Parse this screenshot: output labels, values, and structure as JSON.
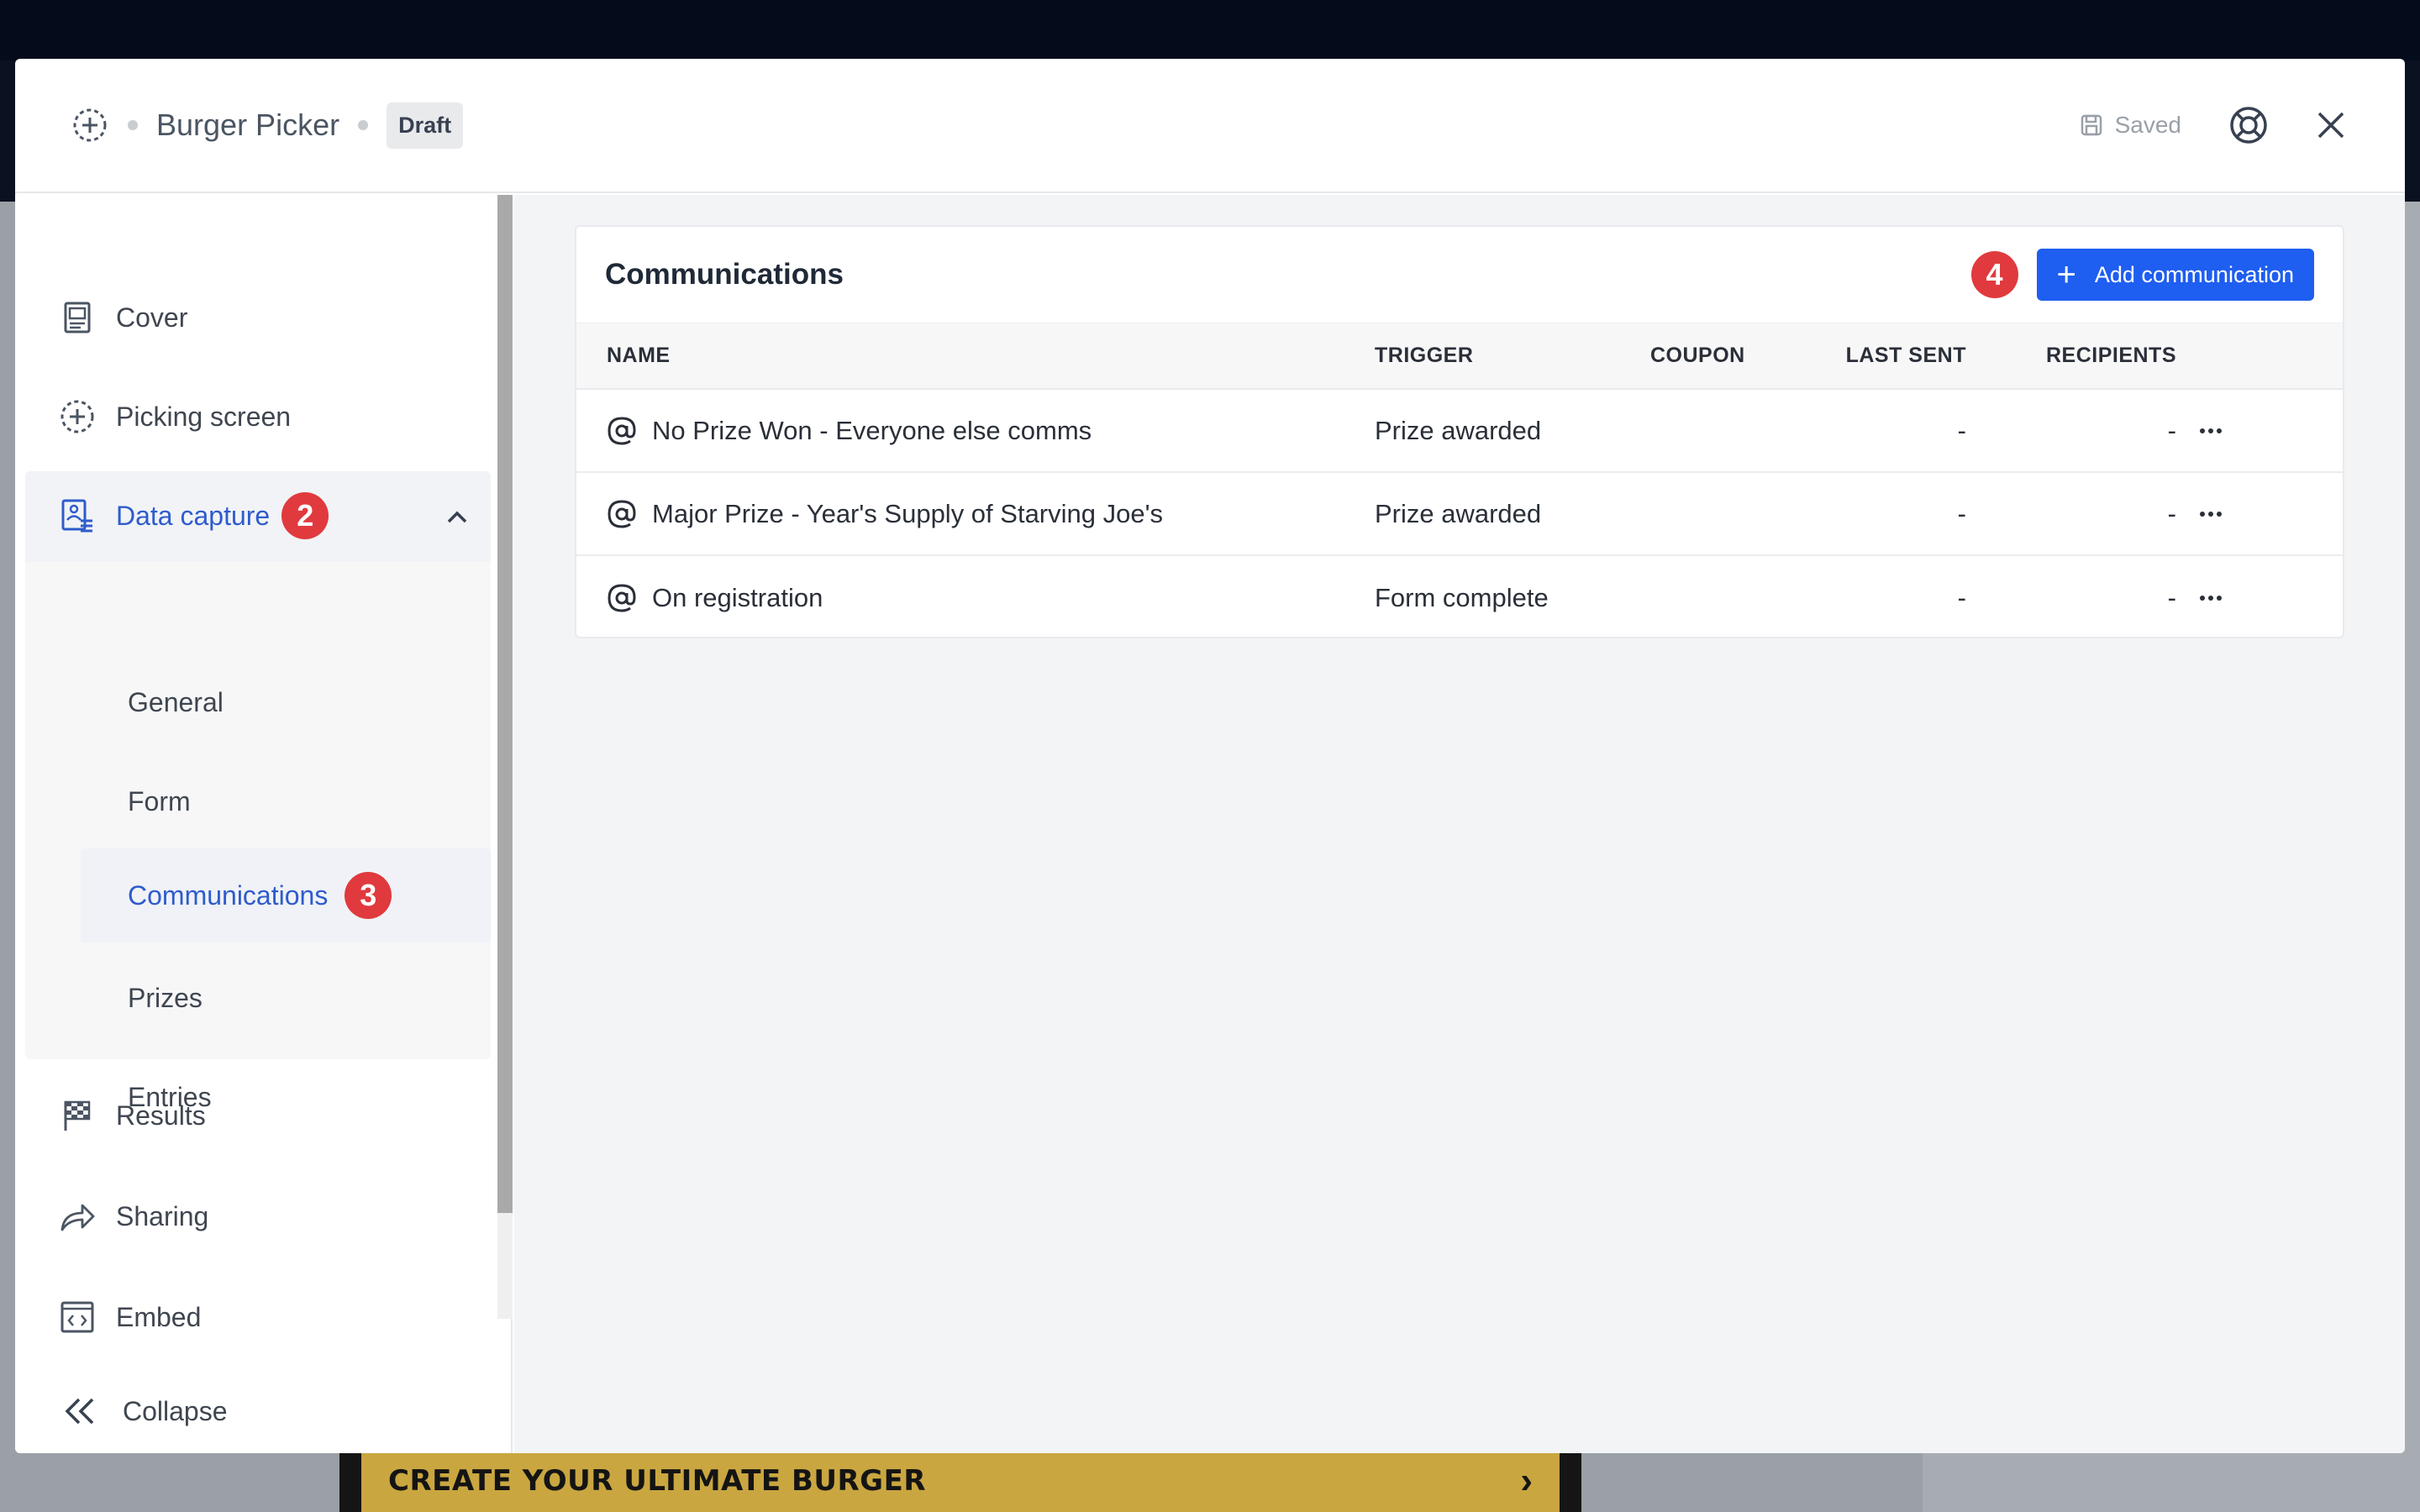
{
  "background": {
    "banner_text": "CREATE YOUR ULTIMATE BURGER"
  },
  "header": {
    "title": "Burger Picker",
    "status_badge": "Draft",
    "saved_label": "Saved"
  },
  "sidebar": {
    "items": [
      {
        "label": "Cover",
        "icon": "cover-icon"
      },
      {
        "label": "Picking screen",
        "icon": "picking-screen-icon"
      },
      {
        "label": "Data capture",
        "icon": "data-capture-icon",
        "badge": "2",
        "expanded": true
      },
      {
        "label": "Results",
        "icon": "checkered-flag-icon"
      },
      {
        "label": "Sharing",
        "icon": "share-arrow-icon"
      },
      {
        "label": "Embed",
        "icon": "embed-icon"
      }
    ],
    "sub_items": [
      {
        "label": "General"
      },
      {
        "label": "Form"
      },
      {
        "label": "Communications",
        "badge": "3",
        "active": true
      },
      {
        "label": "Prizes"
      },
      {
        "label": "Entries"
      }
    ],
    "collapse_label": "Collapse"
  },
  "main": {
    "card_title": "Communications",
    "step_badge": "4",
    "add_button_label": "Add communication",
    "columns": [
      "NAME",
      "TRIGGER",
      "COUPON",
      "LAST SENT",
      "RECIPIENTS"
    ],
    "rows": [
      {
        "name": "No Prize Won - Everyone else comms",
        "trigger": "Prize awarded",
        "coupon": "",
        "last_sent": "-",
        "recipients": "-"
      },
      {
        "name": "Major Prize - Year's Supply of Starving Joe's",
        "trigger": "Prize awarded",
        "coupon": "",
        "last_sent": "-",
        "recipients": "-"
      },
      {
        "name": "On registration",
        "trigger": "Form complete",
        "coupon": "",
        "last_sent": "-",
        "recipients": "-"
      }
    ]
  },
  "colors": {
    "accent": "#1e5ef0",
    "active_text": "#2f5ccc",
    "badge": "#e03a3e"
  }
}
